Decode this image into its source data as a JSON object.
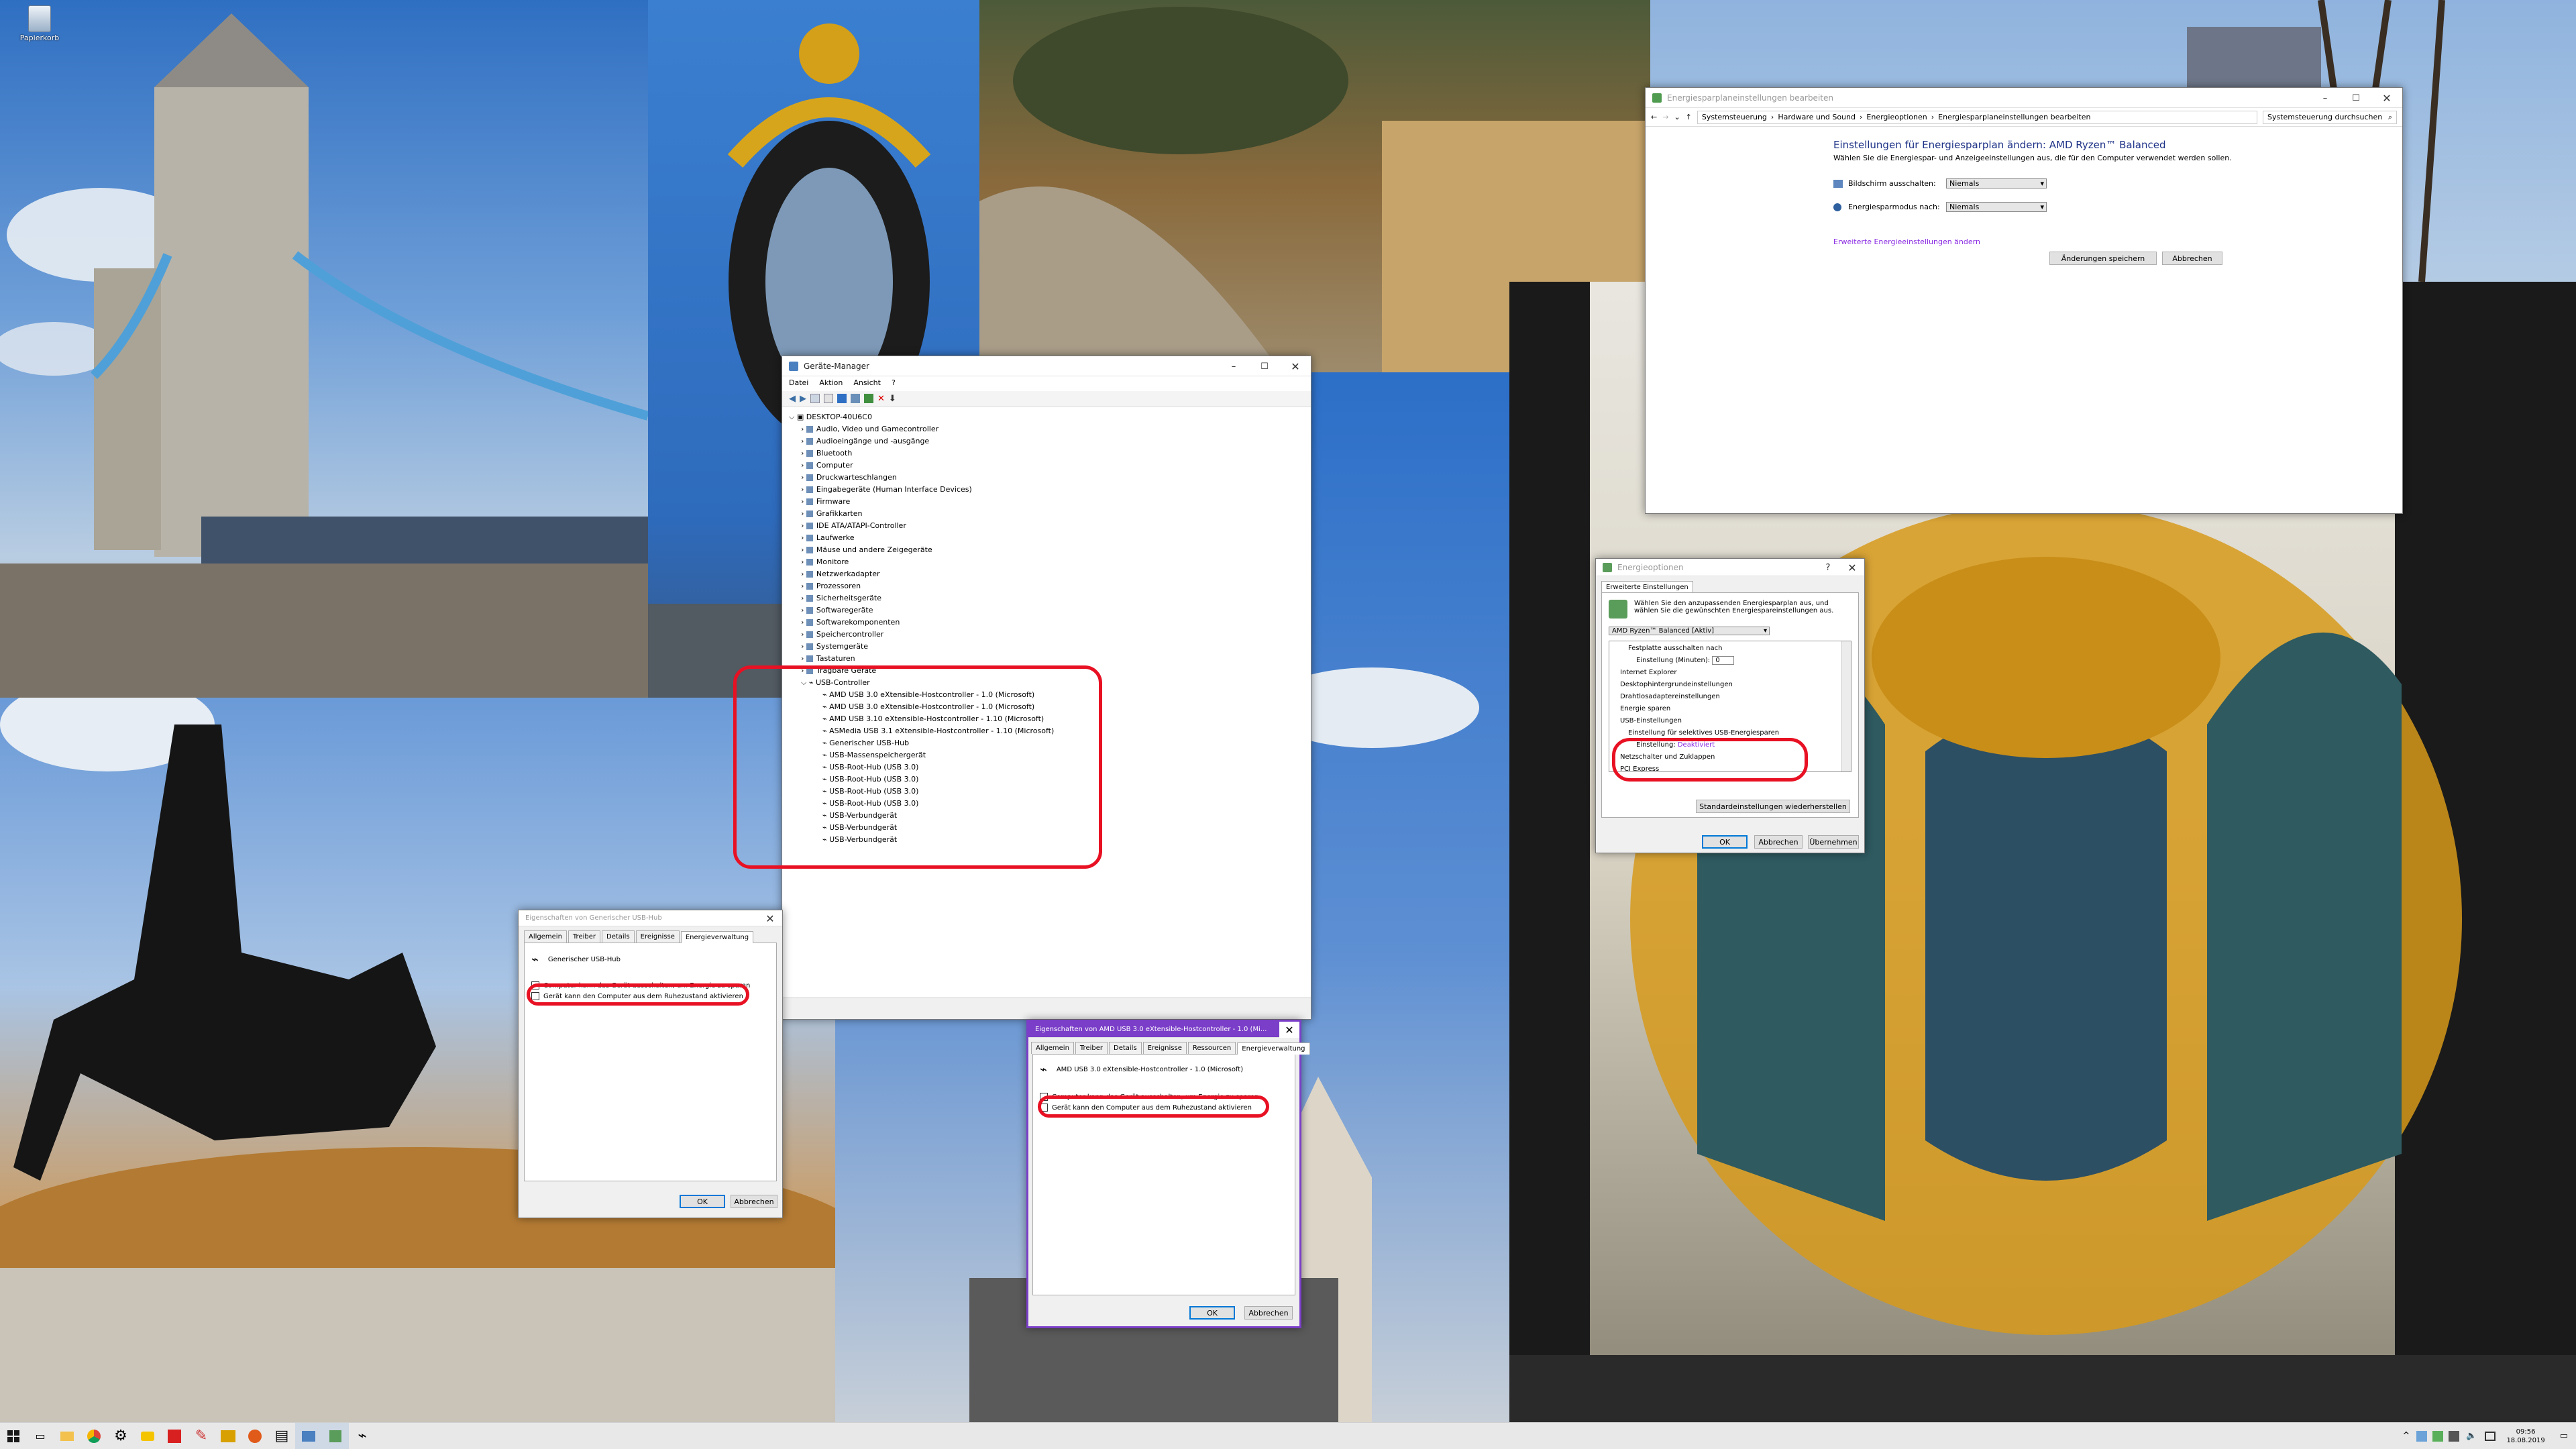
{
  "desktop": {
    "recycle_bin_label": "Papierkorb"
  },
  "device_manager": {
    "title": "Geräte-Manager",
    "menu": [
      "Datei",
      "Aktion",
      "Ansicht",
      "?"
    ],
    "root": "DESKTOP-40U6C0",
    "categories": [
      "Audio, Video und Gamecontroller",
      "Audioeingänge und -ausgänge",
      "Bluetooth",
      "Computer",
      "Druckwarteschlangen",
      "Eingabegeräte (Human Interface Devices)",
      "Firmware",
      "Grafikkarten",
      "IDE ATA/ATAPI-Controller",
      "Laufwerke",
      "Mäuse und andere Zeigegeräte",
      "Monitore",
      "Netzwerkadapter",
      "Prozessoren",
      "Sicherheitsgeräte",
      "Softwaregeräte",
      "Softwarekomponenten",
      "Speichercontroller",
      "Systemgeräte",
      "Tastaturen",
      "Tragbare Geräte"
    ],
    "usb_category": "USB-Controller",
    "usb_devices": [
      "AMD USB 3.0 eXtensible-Hostcontroller - 1.0 (Microsoft)",
      "AMD USB 3.0 eXtensible-Hostcontroller - 1.0 (Microsoft)",
      "AMD USB 3.10 eXtensible-Hostcontroller - 1.10 (Microsoft)",
      "ASMedia USB 3.1 eXtensible-Hostcontroller - 1.10 (Microsoft)",
      "Generischer USB-Hub",
      "USB-Massenspeichergerät",
      "USB-Root-Hub (USB 3.0)",
      "USB-Root-Hub (USB 3.0)",
      "USB-Root-Hub (USB 3.0)",
      "USB-Root-Hub (USB 3.0)",
      "USB-Verbundgerät",
      "USB-Verbundgerät",
      "USB-Verbundgerät"
    ]
  },
  "power_plan": {
    "title": "Energiesparplaneinstellungen bearbeiten",
    "breadcrumb": [
      "Systemsteuerung",
      "Hardware und Sound",
      "Energieoptionen",
      "Energiesparplaneinstellungen bearbeiten"
    ],
    "search_placeholder": "Systemsteuerung durchsuchen",
    "heading": "Einstellungen für Energiesparplan ändern: AMD Ryzen™ Balanced",
    "subheading": "Wählen Sie die Energiespar- und Anzeigeeinstellungen aus, die für den Computer verwendet werden sollen.",
    "display_off_label": "Bildschirm ausschalten:",
    "display_off_value": "Niemals",
    "sleep_label": "Energiesparmodus nach:",
    "sleep_value": "Niemals",
    "advanced_link": "Erweiterte Energieeinstellungen ändern",
    "save_button": "Änderungen speichern",
    "cancel_button": "Abbrechen"
  },
  "power_options": {
    "title": "Energieoptionen",
    "tab": "Erweiterte Einstellungen",
    "description": "Wählen Sie den anzupassenden Energiesparplan aus, und wählen Sie die gewünschten Energiespareinstellungen aus.",
    "plan_select": "AMD Ryzen™ Balanced [Aktiv]",
    "tree": [
      "Festplatte ausschalten nach",
      "Einstellung (Minuten):",
      "Internet Explorer",
      "Desktophintergrundeinstellungen",
      "Drahtlosadaptereinstellungen",
      "Energie sparen",
      "USB-Einstellungen",
      "Einstellung für selektives USB-Energiesparen",
      "Einstellung:",
      "Netzschalter und Zuklappen",
      "PCI Express"
    ],
    "minutes_value": "0",
    "setting_value": "Deaktiviert",
    "restore_button": "Standardeinstellungen wiederherstellen",
    "ok": "OK",
    "cancel": "Abbrechen",
    "apply": "Übernehmen"
  },
  "hub_props": {
    "title": "Eigenschaften von Generischer USB-Hub",
    "tabs": [
      "Allgemein",
      "Treiber",
      "Details",
      "Ereignisse",
      "Energieverwaltung"
    ],
    "device": "Generischer USB-Hub",
    "cb1": "Computer kann das Gerät ausschalten, um Energie zu sparen",
    "cb2": "Gerät kann den Computer aus dem Ruhezustand aktivieren",
    "ok": "OK",
    "cancel": "Abbrechen"
  },
  "amd_props": {
    "title": "Eigenschaften von AMD USB 3.0 eXtensible-Hostcontroller - 1.0 (Mi...",
    "tabs": [
      "Allgemein",
      "Treiber",
      "Details",
      "Ereignisse",
      "Ressourcen",
      "Energieverwaltung"
    ],
    "device": "AMD USB 3.0 eXtensible-Hostcontroller - 1.0 (Microsoft)",
    "cb1": "Computer kann das Gerät ausschalten, um Energie zu sparen",
    "cb2": "Gerät kann den Computer aus dem Ruhezustand aktivieren",
    "ok": "OK",
    "cancel": "Abbrechen"
  },
  "taskbar": {
    "time": "09:56",
    "date": "18.08.2019"
  },
  "colors": {
    "highlight": "#e81123",
    "accent": "#7a3ec8",
    "link": "#8a2be2"
  }
}
